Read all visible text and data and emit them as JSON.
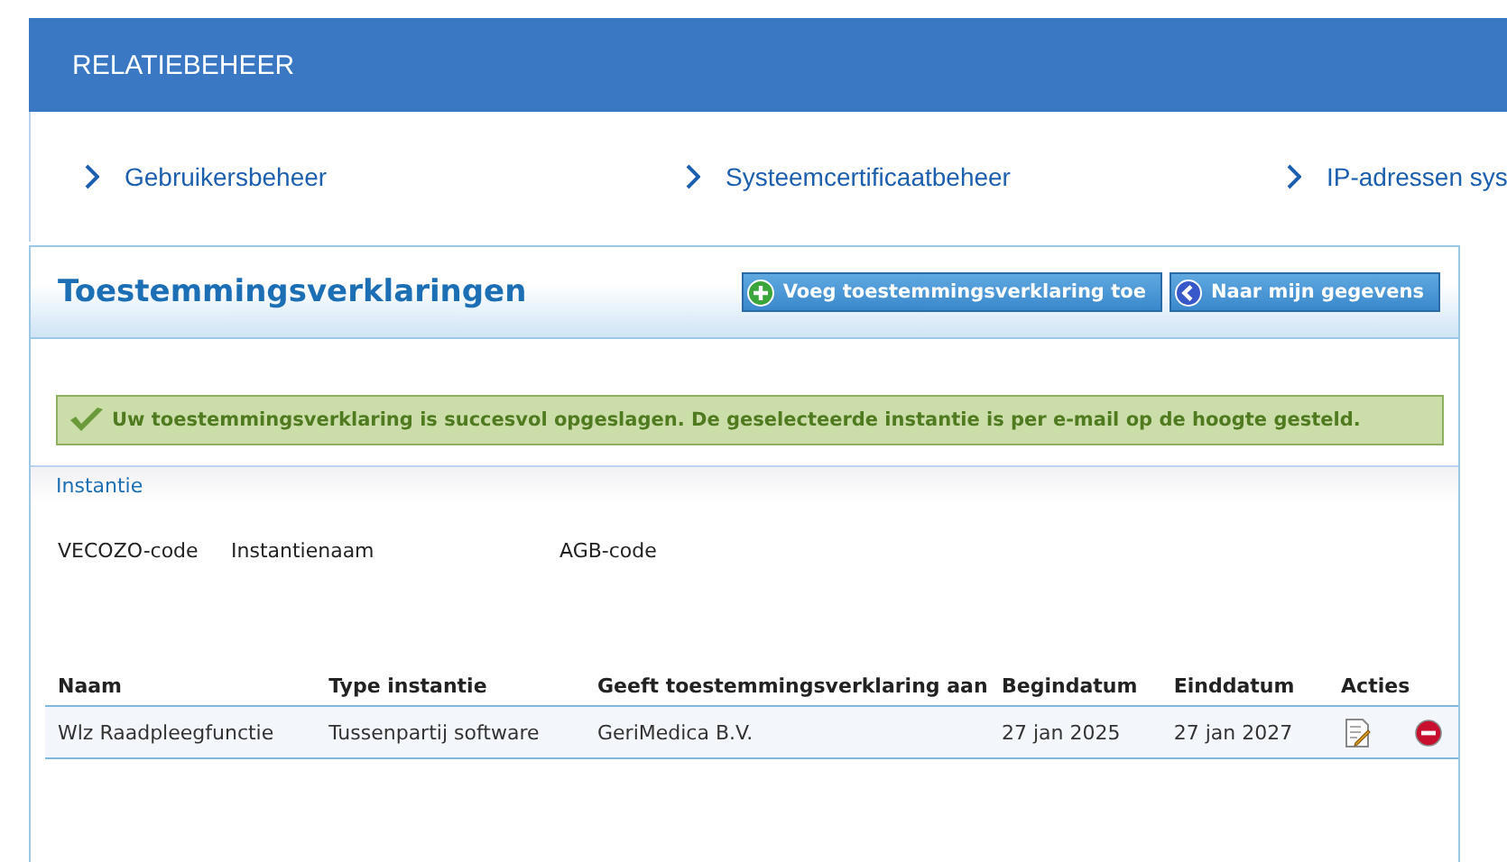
{
  "header": {
    "title": "RELATIEBEHEER"
  },
  "nav": [
    {
      "label": "Gebruikersbeheer"
    },
    {
      "label": "Systeemcertificaatbeheer"
    },
    {
      "label": "IP-adressen sys"
    }
  ],
  "panel": {
    "title": "Toestemmingsverklaringen",
    "buttons": [
      {
        "label": "Voeg toestemmingsverklaring toe",
        "kind": "add"
      },
      {
        "label": "Naar mijn gegevens",
        "kind": "back"
      }
    ]
  },
  "message": "Uw toestemmingsverklaring is succesvol opgeslagen. De geselecteerde instantie is per e-mail op de hoogte gesteld.",
  "instantie": {
    "title": "Instantie",
    "labels": [
      "VECOZO-code",
      "Instantienaam",
      "AGB-code"
    ]
  },
  "table": {
    "columns": [
      "Naam",
      "Type instantie",
      "Geeft toestemmingsverklaring aan",
      "Begindatum",
      "Einddatum",
      "Acties"
    ],
    "rows": [
      {
        "cells": [
          "Wlz Raadpleegfunctie",
          "Tussenpartij software",
          "GeriMedica B.V.",
          "27 jan 2025",
          "27 jan 2027"
        ],
        "actions": [
          {
            "kind": "edit"
          },
          {
            "kind": "delete"
          }
        ]
      }
    ]
  }
}
